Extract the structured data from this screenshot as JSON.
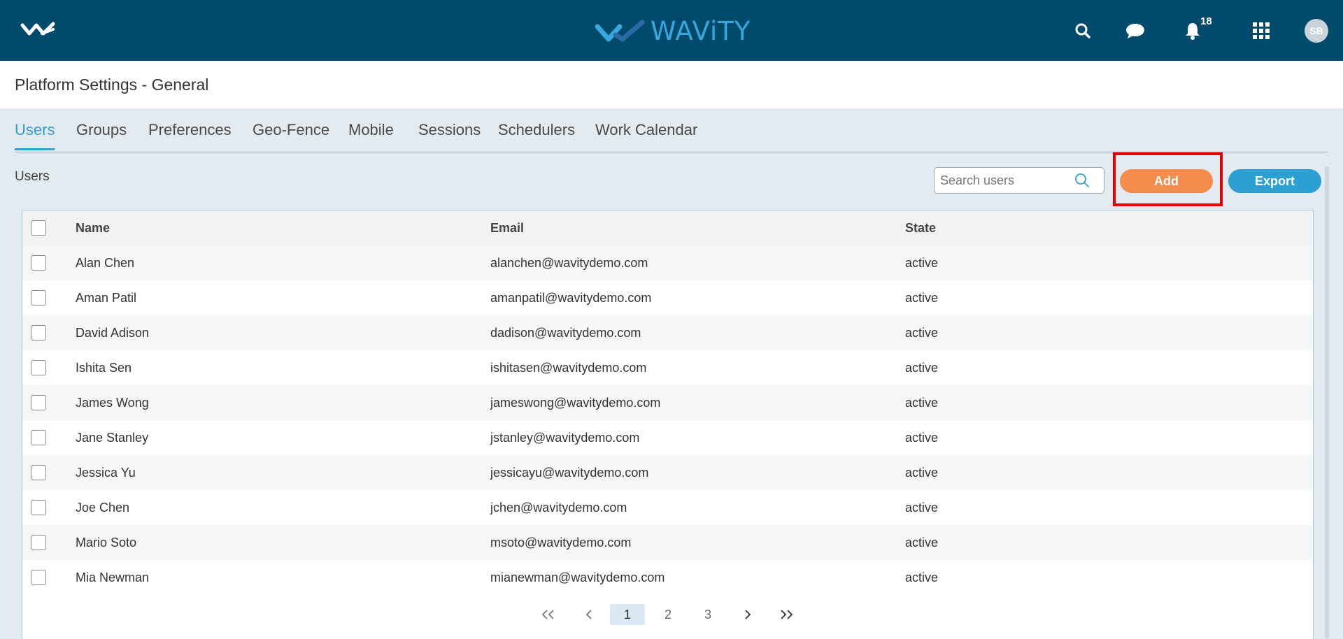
{
  "header": {
    "brand": "WAViTY",
    "notification_count": "18",
    "avatar_initials": "SB",
    "icons": [
      "logo-small-icon",
      "search-icon",
      "chat-icon",
      "bell-icon",
      "apps-grid-icon"
    ]
  },
  "page": {
    "title": "Platform Settings - General"
  },
  "tabs": [
    {
      "label": "Users",
      "active": true
    },
    {
      "label": "Groups"
    },
    {
      "label": "Preferences"
    },
    {
      "label": "Geo-Fence"
    },
    {
      "label": "Mobile"
    },
    {
      "label": "Sessions"
    },
    {
      "label": "Schedulers"
    },
    {
      "label": "Work Calendar"
    }
  ],
  "users_section": {
    "label": "Users",
    "search_placeholder": "Search users",
    "add_label": "Add",
    "export_label": "Export"
  },
  "table": {
    "columns": [
      "Name",
      "Email",
      "State"
    ],
    "rows": [
      {
        "name": "Alan Chen",
        "email": "alanchen@wavitydemo.com",
        "state": "active"
      },
      {
        "name": "Aman Patil",
        "email": "amanpatil@wavitydemo.com",
        "state": "active"
      },
      {
        "name": "David Adison",
        "email": "dadison@wavitydemo.com",
        "state": "active"
      },
      {
        "name": "Ishita Sen",
        "email": "ishitasen@wavitydemo.com",
        "state": "active"
      },
      {
        "name": "James Wong",
        "email": "jameswong@wavitydemo.com",
        "state": "active"
      },
      {
        "name": "Jane Stanley",
        "email": "jstanley@wavitydemo.com",
        "state": "active"
      },
      {
        "name": "Jessica Yu",
        "email": "jessicayu@wavitydemo.com",
        "state": "active"
      },
      {
        "name": "Joe Chen",
        "email": "jchen@wavitydemo.com",
        "state": "active"
      },
      {
        "name": "Mario Soto",
        "email": "msoto@wavitydemo.com",
        "state": "active"
      },
      {
        "name": "Mia Newman",
        "email": "mianewman@wavitydemo.com",
        "state": "active"
      }
    ]
  },
  "pagination": {
    "first": "«",
    "prev": "‹",
    "pages": [
      "1",
      "2",
      "3"
    ],
    "current": "1",
    "next": "›",
    "last": "»"
  },
  "colors": {
    "header_bg": "#004a6b",
    "accent_blue": "#2d9fd3",
    "add_orange": "#f58b4c",
    "highlight_red": "#e00000"
  }
}
